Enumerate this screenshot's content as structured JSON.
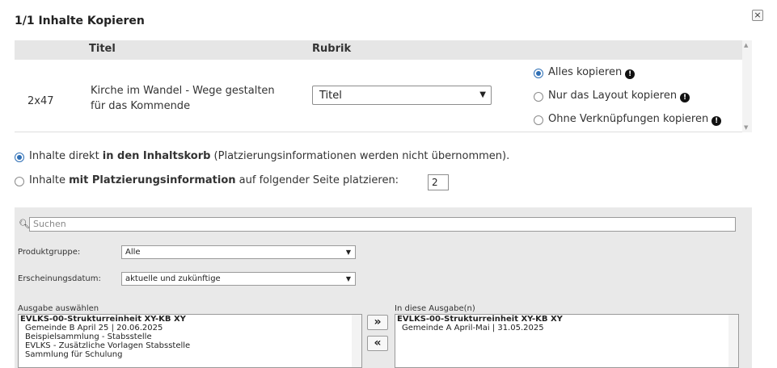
{
  "dialog": {
    "title": "1/1 Inhalte Kopieren",
    "close_icon": "close-icon"
  },
  "table": {
    "headers": [
      "Titel",
      "Rubrik"
    ],
    "row": {
      "id": "2x47",
      "title_line1": "Kirche im Wandel - Wege gestalten",
      "title_line2": "für das Kommende",
      "rubrik": "Titel",
      "options": [
        {
          "label": "Alles kopieren",
          "selected": true
        },
        {
          "label": "Nur das Layout kopieren",
          "selected": false
        },
        {
          "label": "Ohne Verknüpfungen kopieren",
          "selected": false
        }
      ]
    }
  },
  "placement": {
    "option1_pre": "Inhalte direkt ",
    "option1_bold": "in den Inhaltskorb",
    "option1_post": " (Platzierungsinformationen werden nicht übernommen).",
    "option1_selected": true,
    "option2_pre": "Inhalte ",
    "option2_bold": "mit Platzierungsinformation",
    "option2_post": " auf folgender Seite platzieren:",
    "option2_selected": false,
    "page_value": "2"
  },
  "filter": {
    "search_placeholder": "Suchen",
    "produktgruppe_label": "Produktgruppe:",
    "produktgruppe_value": "Alle",
    "datum_label": "Erscheinungsdatum:",
    "datum_value": "aktuelle und zukünftige",
    "left_list_label": "Ausgabe auswählen",
    "right_list_label": "In diese Ausgabe(n)",
    "left_group": "EVLKS-00-Strukturreinheit XY-KB XY",
    "left_items": [
      "Gemeinde B April 25 | 20.06.2025",
      "Beispielsammlung - Stabsstelle",
      "EVLKS - Zusätzliche Vorlagen Stabsstelle",
      "Sammlung für Schulung"
    ],
    "right_group": "EVLKS-00-Strukturreinheit XY-KB XY",
    "right_items": [
      "Gemeinde A April-Mai | 31.05.2025"
    ],
    "add_label": "»",
    "remove_label": "«"
  },
  "colors": {
    "accent": "#2f6fb5",
    "header_bg": "#e6e6e6",
    "panel_bg": "#e9e9e9"
  }
}
